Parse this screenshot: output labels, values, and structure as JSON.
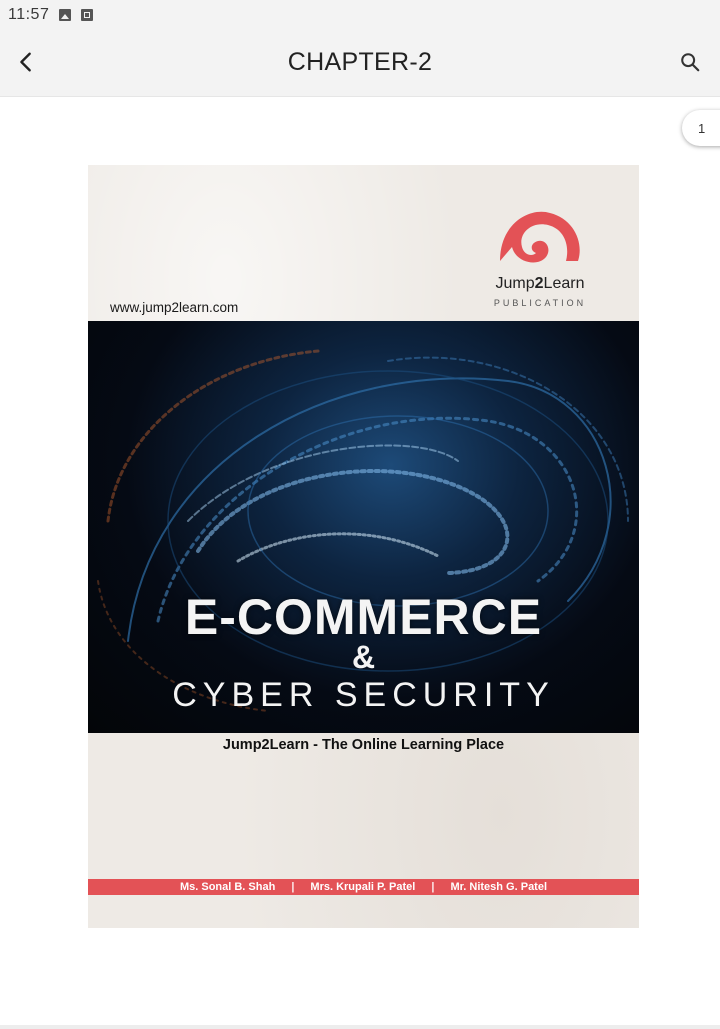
{
  "status_bar": {
    "time": "11:57",
    "icons": [
      "image-icon",
      "app-icon"
    ]
  },
  "app_bar": {
    "title": "CHAPTER-2",
    "back_icon": "chevron-left-icon",
    "search_icon": "search-icon"
  },
  "page_indicator": "1",
  "document": {
    "website": "www.jump2learn.com",
    "publisher_name_prefix": "Jump",
    "publisher_name_bold": "2",
    "publisher_name_suffix": "Learn",
    "publisher_sub": "PUBLICATION",
    "title_line1": "E-COMMERCE",
    "title_amp": "&",
    "title_line2": "CYBER SECURITY",
    "tagline": "Jump2Learn - The Online Learning Place",
    "authors": [
      "Ms. Sonal B. Shah",
      "Mrs. Krupali P. Patel",
      "Mr. Nitesh G. Patel"
    ],
    "author_separator": "|"
  },
  "colors": {
    "brand_red": "#e35256",
    "page_background": "#eeeae5",
    "app_bar": "#f3f3f3"
  }
}
